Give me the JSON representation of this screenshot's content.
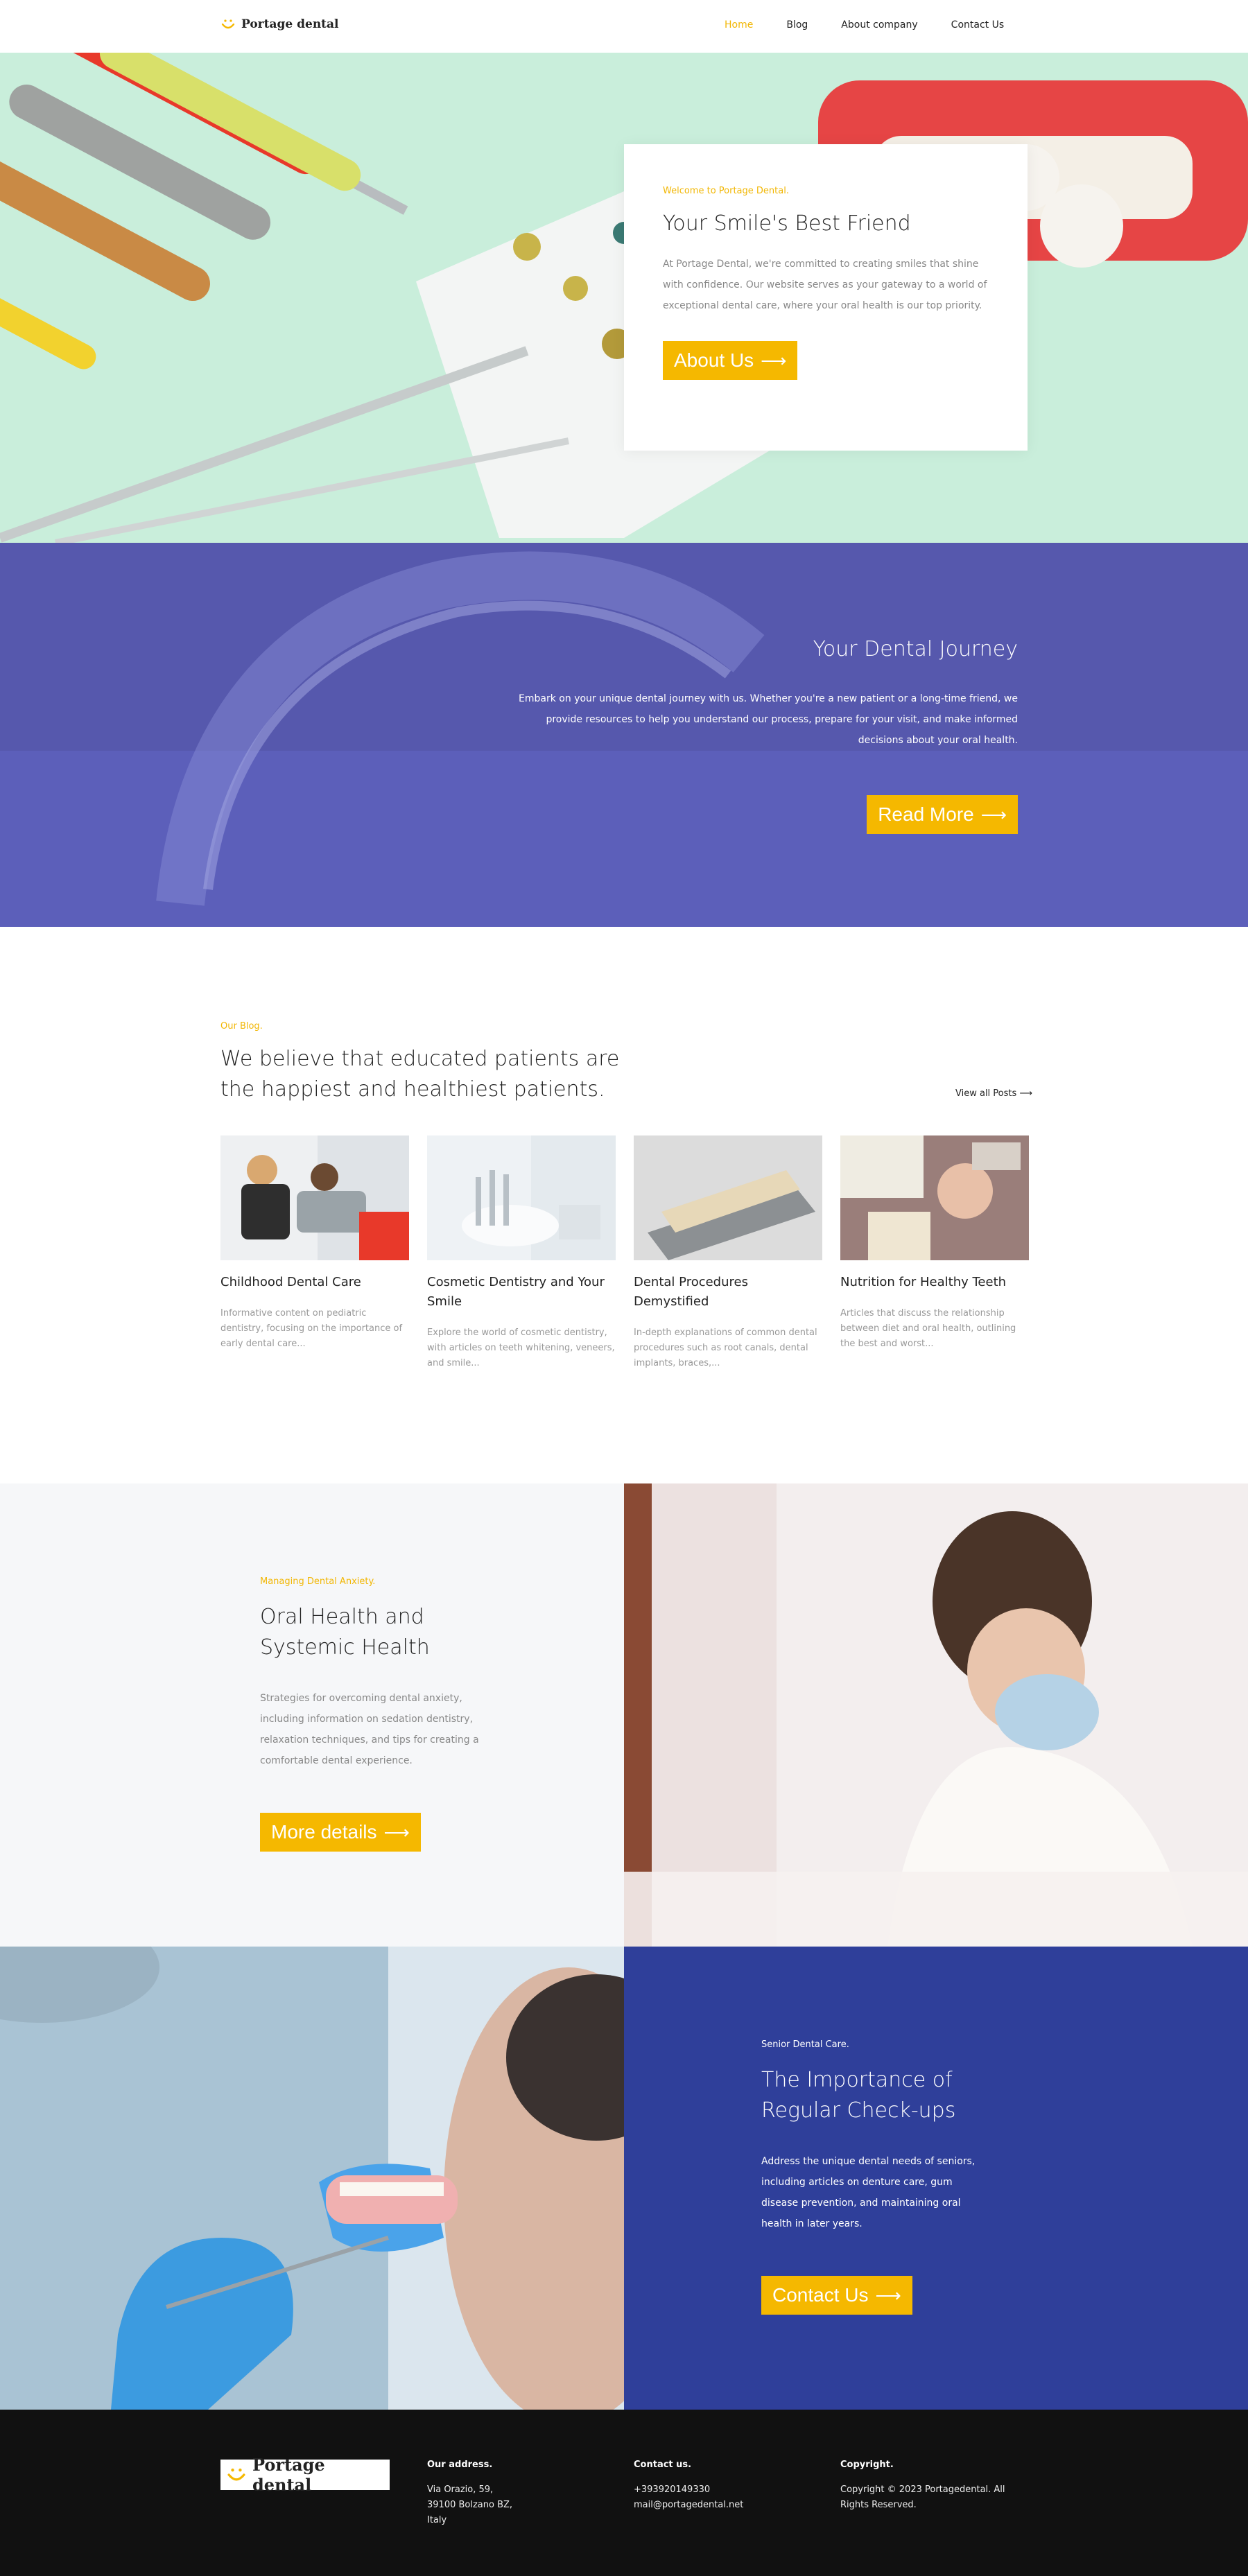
{
  "header": {
    "brand": "Portage dental",
    "nav": [
      "Home",
      "Blog",
      "About company",
      "Contact Us"
    ]
  },
  "hero": {
    "eyebrow": "Welcome to Portage Dental.",
    "title": "Your Smile's Best Friend",
    "text": "At Portage Dental, we're committed to creating smiles that shine with confidence. Our website serves as your gateway to a world of exceptional dental care, where your oral health is our top priority.",
    "button": "About Us"
  },
  "journey": {
    "title": "Your Dental Journey",
    "text": "Embark on your unique dental journey with us. Whether you're a new patient or a long-time friend, we provide resources to help you understand our process, prepare for your visit, and make informed decisions about your oral health.",
    "button": "Read More"
  },
  "blog": {
    "eyebrow": "Our Blog.",
    "title": "We believe that educated patients are the happiest and healthiest patients.",
    "view_all": "View all Posts",
    "posts": [
      {
        "title": "Childhood Dental Care",
        "text": "Informative content on pediatric dentistry, focusing on the importance of early dental care..."
      },
      {
        "title": "Cosmetic Dentistry and Your Smile",
        "text": "Explore the world of cosmetic dentistry, with articles on teeth whitening, veneers, and smile..."
      },
      {
        "title": "Dental Procedures Demystified",
        "text": "In-depth explanations of common dental procedures such as root canals, dental implants, braces,..."
      },
      {
        "title": "Nutrition for Healthy Teeth",
        "text": "Articles that discuss the relationship between diet and oral health, outlining the best and worst..."
      }
    ]
  },
  "anxiety": {
    "eyebrow": "Managing Dental Anxiety.",
    "title": "Oral Health and Systemic Health",
    "text": "Strategies for overcoming dental anxiety, including information on sedation dentistry, relaxation techniques, and tips for creating a comfortable dental experience.",
    "button": "More details"
  },
  "seniors": {
    "eyebrow": "Senior Dental Care.",
    "title": "The Importance of Regular Check-ups",
    "text": "Address the unique dental needs of seniors, including articles on denture care, gum disease prevention, and maintaining oral health in later years.",
    "button": "Contact Us"
  },
  "footer": {
    "brand": "Portage dental",
    "address_title": "Our address.",
    "address_lines": [
      "Via Orazio, 59,",
      "39100 Bolzano BZ,",
      "Italy"
    ],
    "contact_title": "Contact us.",
    "contact_lines": [
      "+393920149330",
      "mail@portagedental.net"
    ],
    "copyright_title": "Copyright.",
    "copyright_text": "Copyright © 2023 Portagedental. All Rights Reserved."
  },
  "colors": {
    "accent": "#f5b800",
    "navy": "#2f3f9a",
    "violet": "#5a5db7",
    "footer": "#111111"
  }
}
